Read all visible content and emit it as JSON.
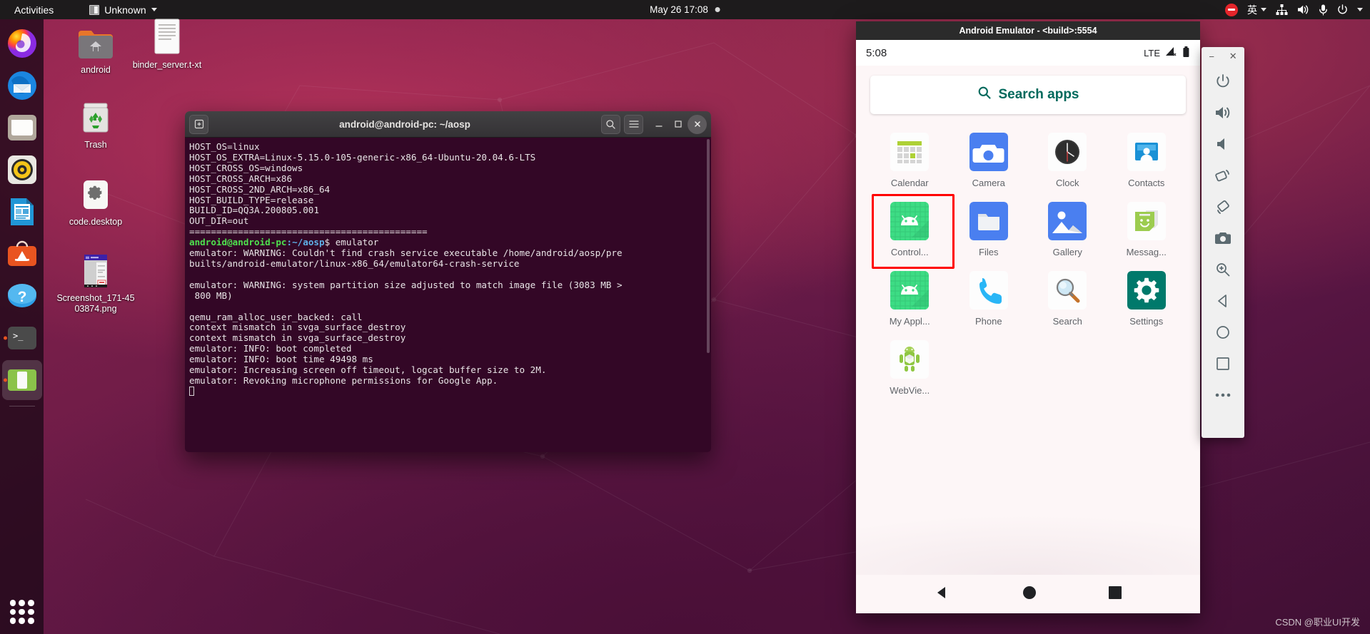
{
  "topbar": {
    "activities": "Activities",
    "app_menu": "Unknown",
    "clock": "May 26  17:08",
    "input_method": "英"
  },
  "desktop": {
    "icons": [
      {
        "name": "android",
        "label": "android",
        "type": "folder"
      },
      {
        "name": "binder_server.txt",
        "label": "binder_server.t-xt",
        "type": "text-file"
      },
      {
        "name": "Trash",
        "label": "Trash",
        "type": "trash"
      },
      {
        "name": "code.desktop",
        "label": "code.desktop",
        "type": "desktop-file"
      },
      {
        "name": "Screenshot_171-4503874.png",
        "label": "Screenshot_171-4503874.png",
        "type": "image-file"
      }
    ]
  },
  "dock": {
    "items": [
      {
        "label": "Firefox",
        "icon": "firefox-icon",
        "running": false
      },
      {
        "label": "Thunderbird Mail",
        "icon": "thunderbird-icon",
        "running": false
      },
      {
        "label": "Files",
        "icon": "files-icon",
        "running": false
      },
      {
        "label": "Rhythmbox",
        "icon": "rhythmbox-icon",
        "running": false
      },
      {
        "label": "LibreOffice Writer",
        "icon": "libreoffice-writer-icon",
        "running": false
      },
      {
        "label": "Ubuntu Software",
        "icon": "ubuntu-software-icon",
        "running": false
      },
      {
        "label": "Help",
        "icon": "help-icon",
        "running": false
      },
      {
        "label": "Terminal",
        "icon": "terminal-icon",
        "running": true
      },
      {
        "label": "Android Emulator",
        "icon": "android-emulator-icon",
        "running": true
      }
    ],
    "show_apps": "Show Applications"
  },
  "terminal": {
    "title": "android@android-pc: ~/aosp",
    "lines": [
      {
        "text": "HOST_OS=linux"
      },
      {
        "text": "HOST_OS_EXTRA=Linux-5.15.0-105-generic-x86_64-Ubuntu-20.04.6-LTS"
      },
      {
        "text": "HOST_CROSS_OS=windows"
      },
      {
        "text": "HOST_CROSS_ARCH=x86"
      },
      {
        "text": "HOST_CROSS_2ND_ARCH=x86_64"
      },
      {
        "text": "HOST_BUILD_TYPE=release"
      },
      {
        "text": "BUILD_ID=QQ3A.200805.001"
      },
      {
        "text": "OUT_DIR=out"
      },
      {
        "text": "============================================"
      },
      {
        "text": "PROMPT",
        "prompt_user": "android@android-pc",
        "prompt_path": ":~/aosp",
        "prompt_cmd": "$ emulator"
      },
      {
        "text": "emulator: WARNING: Couldn't find crash service executable /home/android/aosp/pre"
      },
      {
        "text": "builts/android-emulator/linux-x86_64/emulator64-crash-service"
      },
      {
        "text": ""
      },
      {
        "text": "emulator: WARNING: system partition size adjusted to match image file (3083 MB >"
      },
      {
        "text": " 800 MB)"
      },
      {
        "text": ""
      },
      {
        "text": "qemu_ram_alloc_user_backed: call"
      },
      {
        "text": "context mismatch in svga_surface_destroy"
      },
      {
        "text": "context mismatch in svga_surface_destroy"
      },
      {
        "text": "emulator: INFO: boot completed"
      },
      {
        "text": "emulator: INFO: boot time 49498 ms"
      },
      {
        "text": "emulator: Increasing screen off timeout, logcat buffer size to 2M."
      },
      {
        "text": "emulator: Revoking microphone permissions for Google App."
      }
    ],
    "buttons": {
      "new_tab": "new-tab",
      "search": "search",
      "menu": "menu",
      "minimize": "minimize",
      "maximize": "maximize",
      "close": "close"
    }
  },
  "emulator": {
    "title": "Android Emulator - <build>:5554",
    "status": {
      "time": "5:08",
      "network": "LTE",
      "signal": "signal-off-icon",
      "battery": "battery-icon"
    },
    "search": {
      "label": "Search apps",
      "icon": "search-icon"
    },
    "apps": [
      {
        "label": "Calendar",
        "icon": "calendar-icon",
        "highlight": false
      },
      {
        "label": "Camera",
        "icon": "camera-icon",
        "highlight": false
      },
      {
        "label": "Clock",
        "icon": "clock-icon",
        "highlight": false
      },
      {
        "label": "Contacts",
        "icon": "contacts-icon",
        "highlight": false
      },
      {
        "label": "Control...",
        "icon": "android-app-icon",
        "highlight": true
      },
      {
        "label": "Files",
        "icon": "files-app-icon",
        "highlight": false
      },
      {
        "label": "Gallery",
        "icon": "gallery-icon",
        "highlight": false
      },
      {
        "label": "Messag...",
        "icon": "messaging-icon",
        "highlight": false
      },
      {
        "label": "My Appl...",
        "icon": "android-app-icon",
        "highlight": false
      },
      {
        "label": "Phone",
        "icon": "phone-icon",
        "highlight": false
      },
      {
        "label": "Search",
        "icon": "search-app-icon",
        "highlight": false
      },
      {
        "label": "Settings",
        "icon": "settings-icon",
        "highlight": false
      },
      {
        "label": "WebVie...",
        "icon": "webview-icon",
        "highlight": false
      }
    ],
    "navbar": [
      {
        "name": "back-button",
        "icon": "triangle-back-icon"
      },
      {
        "name": "home-button",
        "icon": "circle-home-icon"
      },
      {
        "name": "recents-button",
        "icon": "square-recents-icon"
      }
    ],
    "toolbar": [
      {
        "name": "power-button",
        "icon": "power-icon"
      },
      {
        "name": "volume-up-button",
        "icon": "volume-up-icon"
      },
      {
        "name": "volume-down-button",
        "icon": "volume-down-icon"
      },
      {
        "name": "rotate-left-button",
        "icon": "rotate-left-icon"
      },
      {
        "name": "rotate-right-button",
        "icon": "rotate-right-icon"
      },
      {
        "name": "screenshot-button",
        "icon": "camera-icon"
      },
      {
        "name": "zoom-button",
        "icon": "zoom-in-icon"
      },
      {
        "name": "back-button",
        "icon": "triangle-back-icon"
      },
      {
        "name": "home-button",
        "icon": "circle-home-icon"
      },
      {
        "name": "recents-button",
        "icon": "square-recents-icon"
      },
      {
        "name": "more-button",
        "icon": "ellipsis-icon"
      }
    ],
    "window_buttons": {
      "minimize": "−",
      "close": "✕"
    }
  },
  "watermark": "CSDN @职业UI开发",
  "colors": {
    "accent_orange": "#e95420",
    "highlight_red": "#ff0000",
    "terminal_bg": "#330726",
    "topbar_bg": "#1d1b1c",
    "android_green": "#3ddc84",
    "teal": "#00695c"
  }
}
